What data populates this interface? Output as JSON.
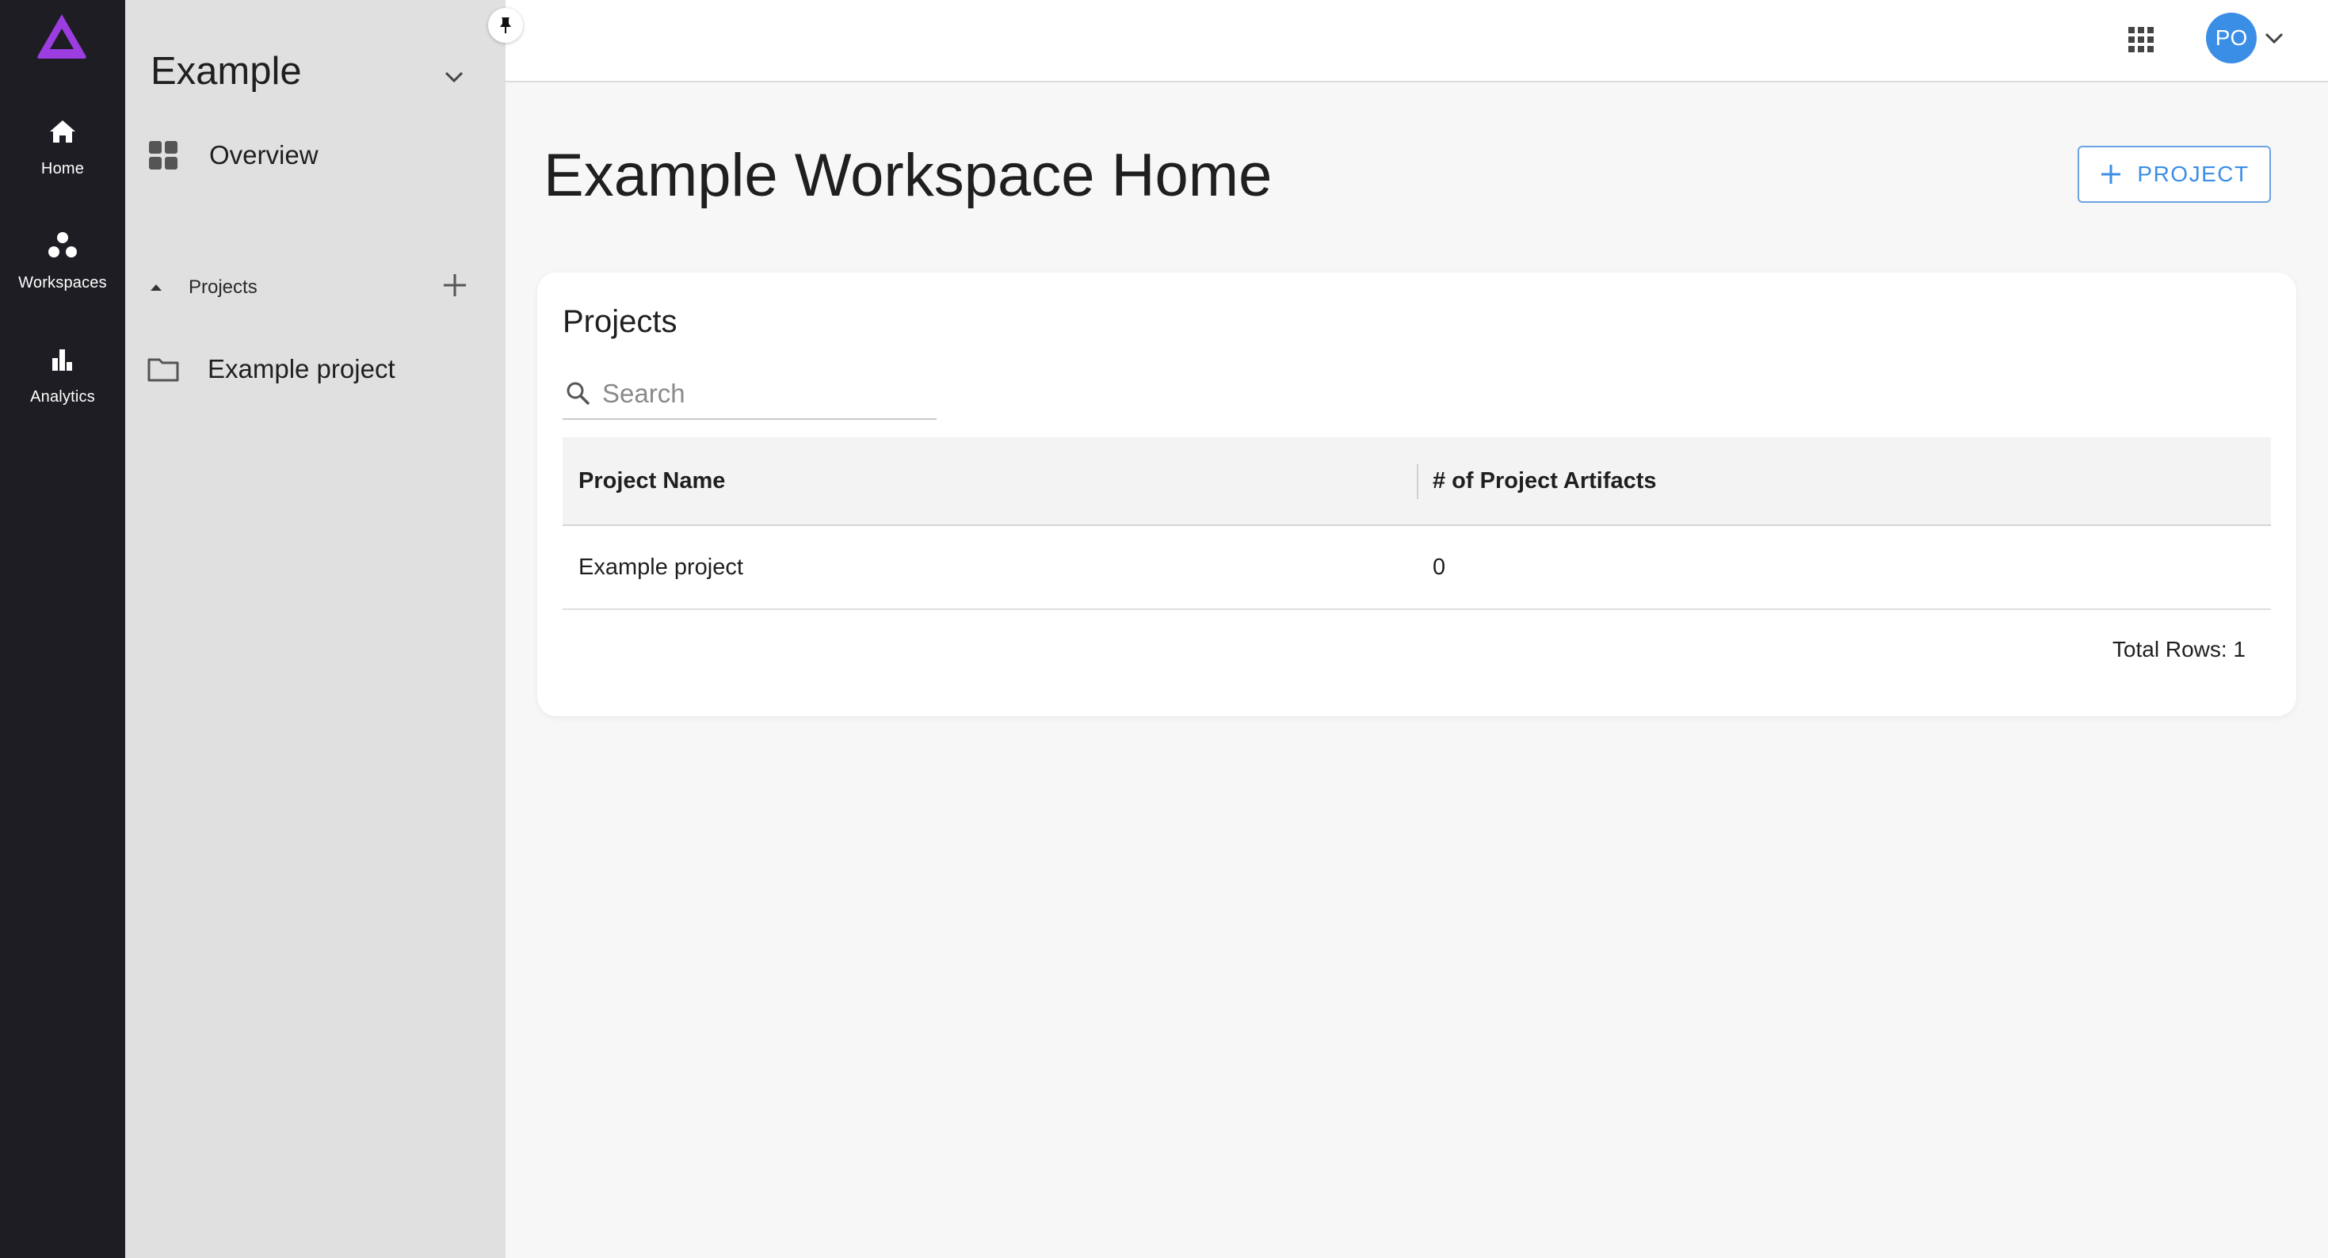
{
  "rail": {
    "items": [
      {
        "label": "Home",
        "icon": "home-icon"
      },
      {
        "label": "Workspaces",
        "icon": "workspaces-icon"
      },
      {
        "label": "Analytics",
        "icon": "analytics-icon"
      }
    ],
    "logo_color": "#9b3de0"
  },
  "sidebar": {
    "workspace_name": "Example",
    "overview_label": "Overview",
    "projects_label": "Projects",
    "projects": [
      {
        "label": "Example project"
      }
    ]
  },
  "topbar": {
    "avatar_initials": "PO",
    "avatar_color": "#3b8ee6"
  },
  "main": {
    "title": "Example Workspace Home",
    "add_project_label": "PROJECT",
    "card": {
      "title": "Projects",
      "search_placeholder": "Search",
      "columns": [
        "Project Name",
        "# of Project Artifacts"
      ],
      "rows": [
        {
          "name": "Example project",
          "artifacts": "0"
        }
      ],
      "total_rows": "Total Rows: 1"
    }
  }
}
